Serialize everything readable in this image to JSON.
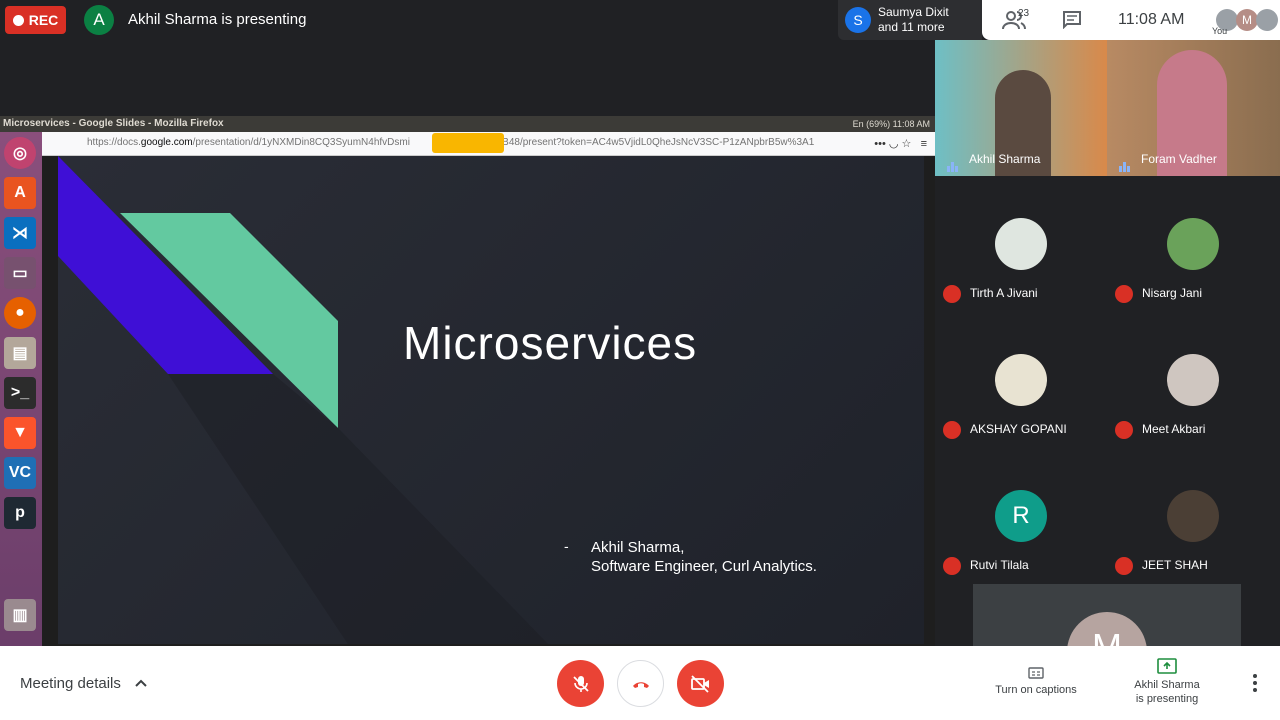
{
  "meeting": {
    "rec_label": "REC",
    "presenter_initial": "A",
    "presenter_text": "Akhil Sharma is presenting",
    "notification_initial": "S",
    "notification_line1": "Saumya Dixit",
    "notification_line2": "and 11 more",
    "participant_count": "23",
    "clock": "11:08 AM",
    "self_label": "You",
    "self_initial": "M"
  },
  "browser": {
    "window_title": "Microservices - Google Slides - Mozilla Firefox",
    "status_text": "En  (69%)  11:08 AM",
    "url_prefix": "https://docs.",
    "url_domain": "google.com",
    "url_rest": "/presentation/d/1yNXMDin8CQ3SyumN4hfvDsmi",
    "url_tail": "xPcdB48/present?token=AC4w5VjidL0QheJsNcV3SC-P1zANpbrB5w%3A1",
    "dock_apps": [
      "ubuntu-icon",
      "software-center-icon",
      "vscode-icon",
      "files-icon",
      "firefox-icon",
      "archive-icon",
      "terminal-icon",
      "brave-icon",
      "vc-icon",
      "p-app-icon",
      "trash-icon"
    ]
  },
  "slide": {
    "title": "Microservices",
    "dash": "-",
    "author_line1": "Akhil Sharma,",
    "author_line2": "Software Engineer, Curl Analytics."
  },
  "participants": {
    "video": [
      {
        "name": "Akhil Sharma"
      },
      {
        "name": "Foram Vadher"
      }
    ],
    "tiles": [
      {
        "name": "Tirth A Jivani",
        "initial": ""
      },
      {
        "name": "Nisarg Jani",
        "initial": ""
      },
      {
        "name": "AKSHAY GOPANI",
        "initial": ""
      },
      {
        "name": "Meet Akbari",
        "initial": ""
      },
      {
        "name": "Rutvi Tilala",
        "initial": "R"
      },
      {
        "name": "JEET SHAH",
        "initial": ""
      }
    ],
    "self_initial": "M"
  },
  "controls": {
    "meeting_details": "Meeting details",
    "captions_label": "Turn on captions",
    "presenting_line1": "Akhil Sharma",
    "presenting_line2": "is presenting"
  },
  "colors": {
    "rec_red": "#d93025",
    "slide_purple": "#3f0fd6",
    "slide_green": "#63c9a0",
    "mic_off_red": "#ea4335"
  }
}
